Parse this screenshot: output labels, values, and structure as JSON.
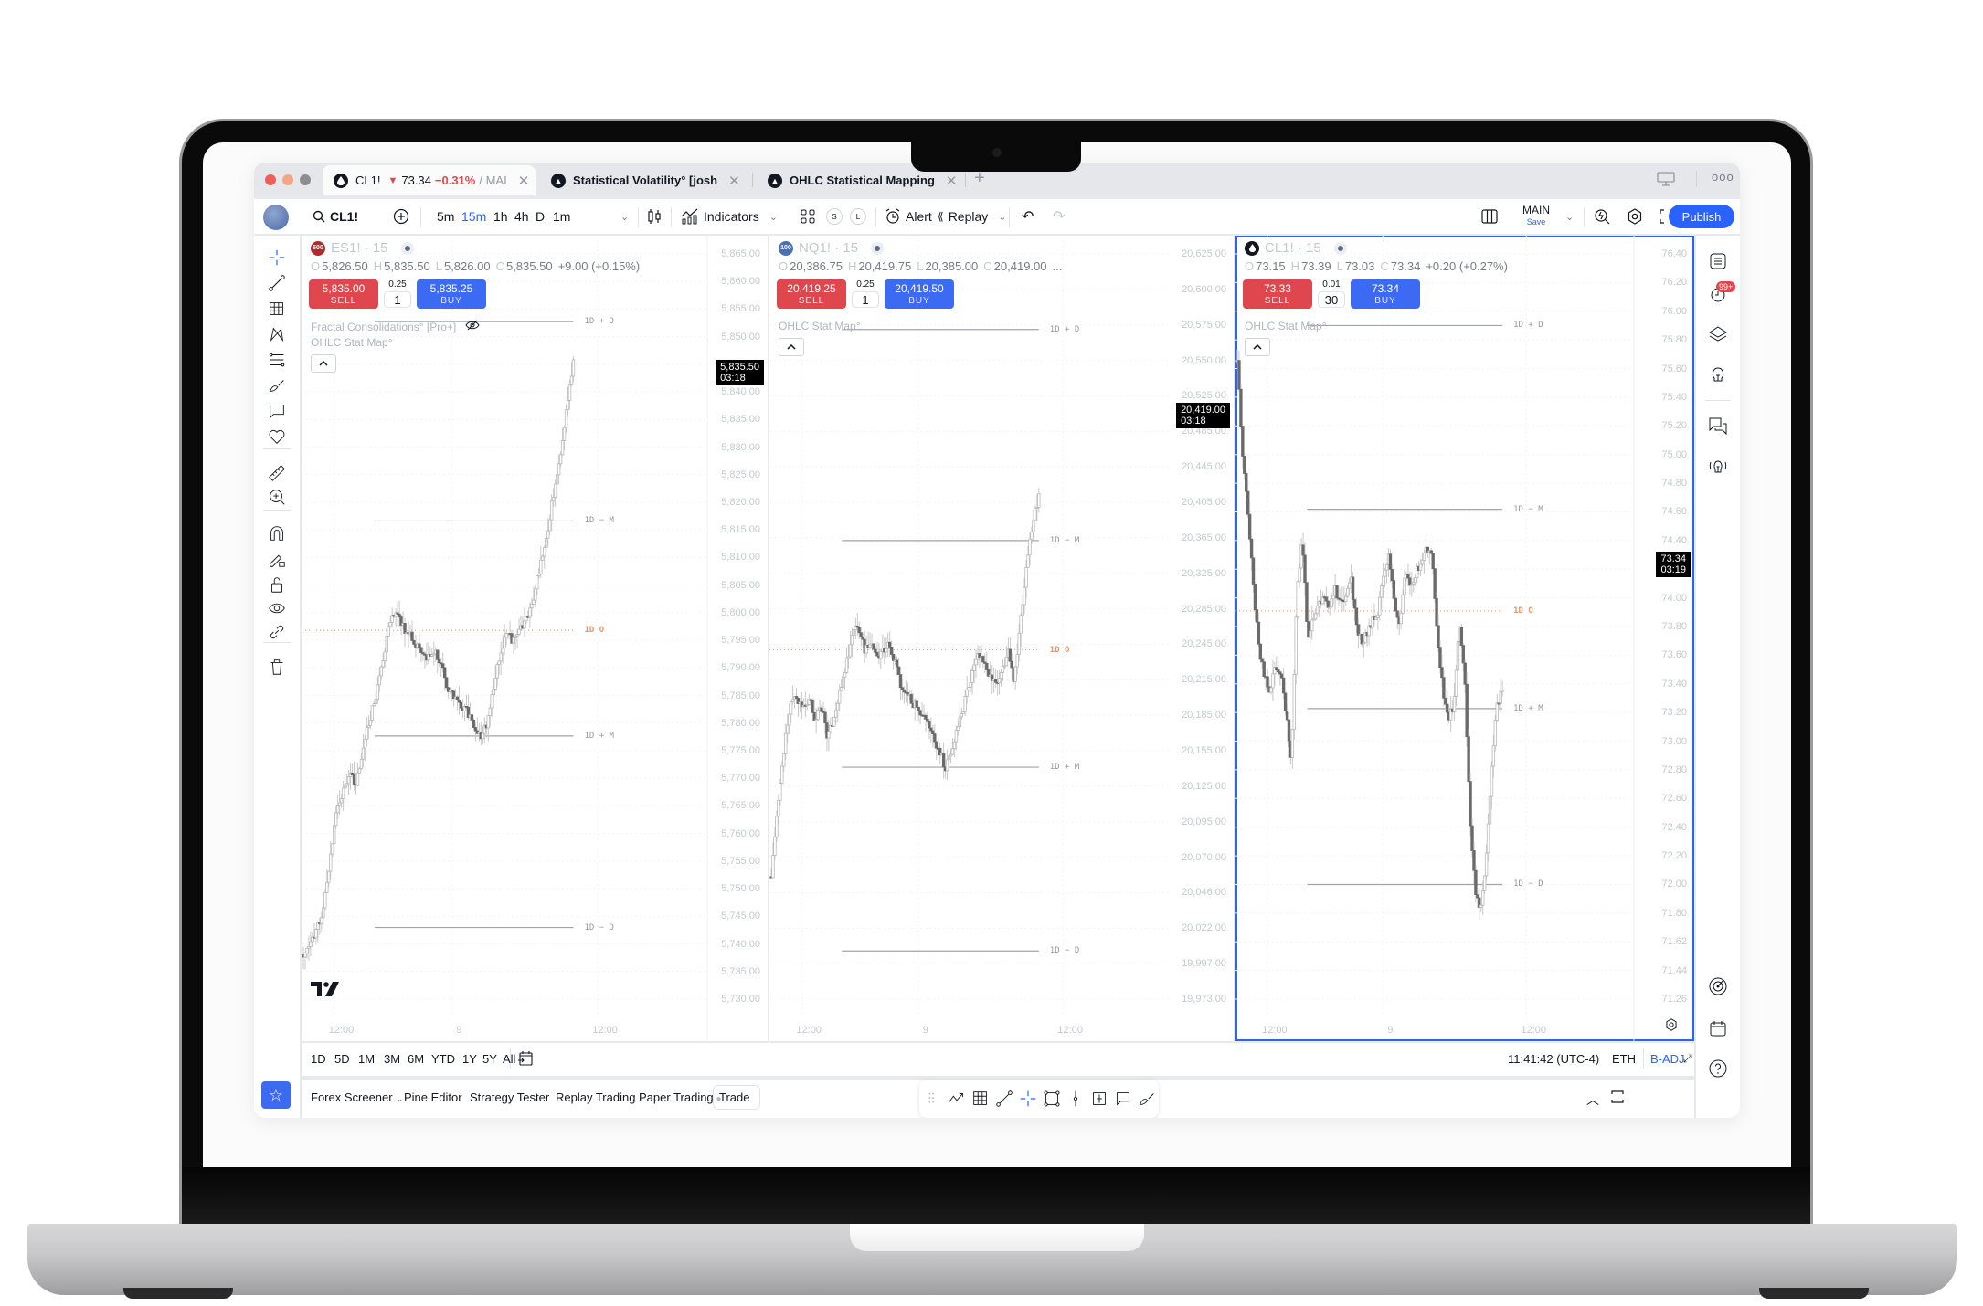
{
  "tabs": [
    {
      "icon": "oil-drop-icon",
      "symbol": "CL1!",
      "arrow": "▼",
      "price": "73.34",
      "change": "−0.31%",
      "suffix": "/ MAI",
      "active": true
    },
    {
      "icon": "indicator-logo-icon",
      "label": "Statistical Volatility° [josh",
      "active": false
    },
    {
      "icon": "indicator-logo-icon",
      "label": "OHLC Statistical Mapping",
      "active": false
    }
  ],
  "toolbar": {
    "symbol": "CL1!",
    "intervals": [
      "5m",
      "15m",
      "1h",
      "4h",
      "D",
      "1m"
    ],
    "active_interval": "15m",
    "indicators_label": "Indicators",
    "alert_label": "Alert",
    "replay_label": "Replay",
    "layout_name": "MAIN",
    "layout_save": "Save",
    "publish_label": "Publish",
    "s_label": "S",
    "l_label": "L"
  },
  "colors": {
    "accent": "#2962ff",
    "sell": "#e0464e",
    "buy": "#3d6af2",
    "open_level": "#e8956a",
    "candle_up": "#b8b8b8",
    "candle_down": "#6a6a6a"
  },
  "charts": [
    {
      "symbol": "ES1!",
      "badge": "500",
      "badge_color": "#b02a30",
      "interval": "15",
      "ohlc": {
        "o": "5,826.50",
        "h": "5,835.50",
        "l": "5,826.00",
        "c": "5,835.50",
        "chg": "+9.00 (+0.15%)"
      },
      "sell": "5,835.00",
      "buy": "5,835.25",
      "tick": "0.25",
      "qty": "1",
      "indicators": [
        "Fractal Consolidations° [Pro+]",
        "OHLC Stat Map°"
      ],
      "price_ticks": [
        "5,865.00",
        "5,860.00",
        "5,855.00",
        "5,850.00",
        "5,845.00",
        "5,840.00",
        "5,835.00",
        "5,830.00",
        "5,825.00",
        "5,820.00",
        "5,815.00",
        "5,810.00",
        "5,805.00",
        "5,800.00",
        "5,795.00",
        "5,790.00",
        "5,785.00",
        "5,780.00",
        "5,775.00",
        "5,770.00",
        "5,765.00",
        "5,760.00",
        "5,755.00",
        "5,750.00",
        "5,745.00",
        "5,740.00",
        "5,735.00",
        "5,730.00"
      ],
      "last_price": "5,835.50",
      "countdown": "03:18",
      "time_ticks": [
        "12:00",
        "9",
        "12:00"
      ],
      "levels": [
        {
          "label": "1D + D",
          "pos": 0.11,
          "open": false
        },
        {
          "label": "1D − M",
          "pos": 0.365,
          "open": false
        },
        {
          "label": "1D O",
          "pos": 0.505,
          "open": true
        },
        {
          "label": "1D + M",
          "pos": 0.64,
          "open": false
        },
        {
          "label": "1D − D",
          "pos": 0.885,
          "open": false
        }
      ],
      "path": [
        0.92,
        0.91,
        0.89,
        0.86,
        0.8,
        0.74,
        0.71,
        0.69,
        0.7,
        0.66,
        0.62,
        0.59,
        0.55,
        0.5,
        0.48,
        0.5,
        0.51,
        0.52,
        0.53,
        0.54,
        0.53,
        0.55,
        0.58,
        0.59,
        0.6,
        0.61,
        0.63,
        0.64,
        0.62,
        0.57,
        0.53,
        0.51,
        0.52,
        0.5,
        0.49,
        0.46,
        0.42,
        0.38,
        0.33,
        0.28,
        0.22,
        0.16
      ]
    },
    {
      "symbol": "NQ1!",
      "badge": "100",
      "badge_color": "#4a6fb5",
      "interval": "15",
      "ohlc": {
        "o": "20,386.75",
        "h": "20,419.75",
        "l": "20,385.00",
        "c": "20,419.00",
        "chg": "..."
      },
      "sell": "20,419.25",
      "buy": "20,419.50",
      "tick": "0.25",
      "qty": "1",
      "indicators": [
        "OHLC Stat Map°"
      ],
      "price_ticks": [
        "20,625.00",
        "20,600.00",
        "20,575.00",
        "20,550.00",
        "20,525.00",
        "20,485.00",
        "20,445.00",
        "20,405.00",
        "20,365.00",
        "20,325.00",
        "20,285.00",
        "20,245.00",
        "20,215.00",
        "20,185.00",
        "20,155.00",
        "20,125.00",
        "20,095.00",
        "20,070.00",
        "20,046.00",
        "20,022.00",
        "19,997.00",
        "19,973.00"
      ],
      "last_price": "20,419.00",
      "countdown": "03:18",
      "time_ticks": [
        "12:00",
        "9",
        "12:00"
      ],
      "levels": [
        {
          "label": "1D + D",
          "pos": 0.12,
          "open": false
        },
        {
          "label": "1D − M",
          "pos": 0.39,
          "open": false
        },
        {
          "label": "1D O",
          "pos": 0.53,
          "open": true
        },
        {
          "label": "1D + M",
          "pos": 0.68,
          "open": false
        },
        {
          "label": "1D − D",
          "pos": 0.915,
          "open": false
        }
      ],
      "path": [
        0.82,
        0.73,
        0.66,
        0.6,
        0.59,
        0.61,
        0.59,
        0.62,
        0.6,
        0.64,
        0.62,
        0.58,
        0.55,
        0.51,
        0.5,
        0.53,
        0.52,
        0.54,
        0.53,
        0.52,
        0.55,
        0.58,
        0.59,
        0.6,
        0.61,
        0.62,
        0.64,
        0.66,
        0.68,
        0.66,
        0.63,
        0.6,
        0.57,
        0.54,
        0.54,
        0.56,
        0.57,
        0.56,
        0.53,
        0.57,
        0.5,
        0.42,
        0.37,
        0.33
      ]
    },
    {
      "symbol": "CL1!",
      "badge": "",
      "badge_color": "#131722",
      "interval": "15",
      "ohlc": {
        "o": "73.15",
        "h": "73.39",
        "l": "73.03",
        "c": "73.34",
        "chg": "+0.20 (+0.27%)"
      },
      "sell": "73.33",
      "buy": "73.34",
      "tick": "0.01",
      "qty": "30",
      "indicators": [
        "OHLC Stat Map°"
      ],
      "price_ticks": [
        "76.40",
        "76.20",
        "76.00",
        "75.80",
        "75.60",
        "75.40",
        "75.20",
        "75.00",
        "74.80",
        "74.60",
        "74.40",
        "74.20",
        "74.00",
        "73.80",
        "73.60",
        "73.40",
        "73.20",
        "73.00",
        "72.80",
        "72.60",
        "72.40",
        "72.20",
        "72.00",
        "71.80",
        "71.62",
        "71.44",
        "71.26"
      ],
      "last_price": "73.34",
      "countdown": "03:19",
      "time_ticks": [
        "12:00",
        "9",
        "12:00"
      ],
      "levels": [
        {
          "label": "1D + D",
          "pos": 0.115,
          "open": false
        },
        {
          "label": "1D − M",
          "pos": 0.35,
          "open": false
        },
        {
          "label": "1D O",
          "pos": 0.48,
          "open": true
        },
        {
          "label": "1D + M",
          "pos": 0.605,
          "open": false
        },
        {
          "label": "1D − D",
          "pos": 0.83,
          "open": false
        }
      ],
      "path": [
        0.16,
        0.28,
        0.36,
        0.45,
        0.53,
        0.56,
        0.58,
        0.55,
        0.56,
        0.61,
        0.68,
        0.46,
        0.38,
        0.52,
        0.49,
        0.47,
        0.46,
        0.48,
        0.45,
        0.47,
        0.46,
        0.44,
        0.5,
        0.52,
        0.51,
        0.49,
        0.48,
        0.43,
        0.41,
        0.47,
        0.5,
        0.43,
        0.45,
        0.43,
        0.42,
        0.4,
        0.41,
        0.52,
        0.58,
        0.62,
        0.6,
        0.5,
        0.56,
        0.75,
        0.84,
        0.86,
        0.8,
        0.68,
        0.6,
        0.58
      ]
    }
  ],
  "left_tools": [
    "crosshair-icon",
    "trendline-icon",
    "fib-grid-icon",
    "pattern-icon",
    "parallel-channel-icon",
    "brush-icon",
    "text-callout-icon",
    "heart-icon",
    "ruler-icon",
    "zoom-in-icon",
    "magnet-icon",
    "lock-drawing-icon",
    "unlock-icon",
    "eye-icon",
    "link-icon",
    "trash-icon"
  ],
  "right_tools": [
    "watchlist-icon",
    "alerts-clock-icon",
    "layers-icon",
    "ideas-bulb-icon",
    "chat-icon",
    "signals-bulb-icon",
    "target-icon",
    "calendar-icon",
    "help-icon"
  ],
  "notifications_badge": "99+",
  "range_bar": {
    "ranges": [
      "1D",
      "5D",
      "1M",
      "3M",
      "6M",
      "YTD",
      "1Y",
      "5Y",
      "All"
    ],
    "clock": "11:41:42 (UTC-4)",
    "session": "ETH",
    "adjustment": "B-ADJ"
  },
  "bottom_panel": {
    "items": [
      "Forex Screener",
      "Pine Editor",
      "Strategy Tester",
      "Replay Trading",
      "Paper Trading",
      "Trade"
    ]
  }
}
